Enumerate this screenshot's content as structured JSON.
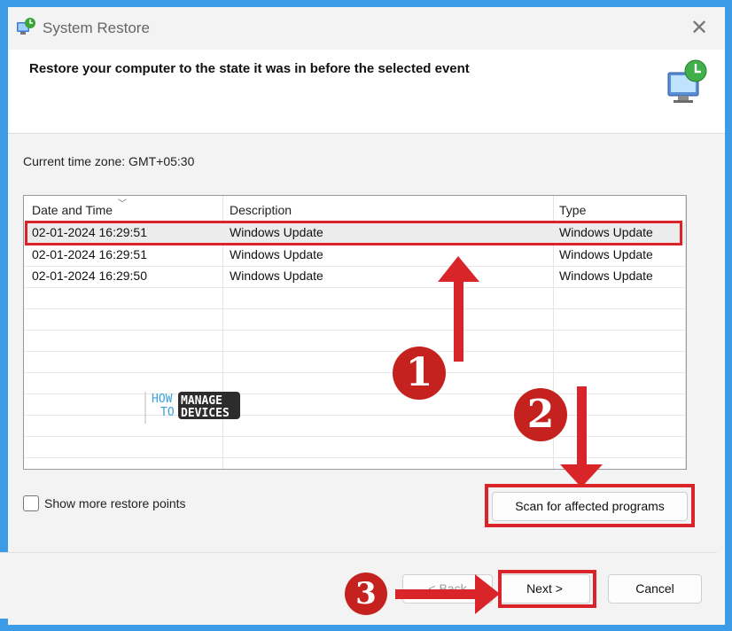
{
  "window": {
    "title": "System Restore",
    "close_glyph": "✕"
  },
  "header": {
    "heading": "Restore your computer to the state it was in before the selected event"
  },
  "timezone_label": "Current time zone: GMT+05:30",
  "table": {
    "columns": [
      "Date and Time",
      "Description",
      "Type"
    ],
    "rows": [
      {
        "date": "02-01-2024 16:29:51",
        "description": "Windows Update",
        "type": "Windows Update"
      },
      {
        "date": "02-01-2024 16:29:51",
        "description": "Windows Update",
        "type": "Windows Update"
      },
      {
        "date": "02-01-2024 16:29:50",
        "description": "Windows Update",
        "type": "Windows Update"
      }
    ]
  },
  "watermark": {
    "how": "HOW",
    "to": "TO",
    "manage": "MANAGE",
    "devices": "DEVICES"
  },
  "checkbox": {
    "label": "Show more restore points",
    "checked": false
  },
  "buttons": {
    "scan": "Scan for affected programs",
    "back": "< Back",
    "next": "Next >",
    "cancel": "Cancel"
  },
  "annotations": {
    "step1": "1",
    "step2": "2",
    "step3": "3",
    "color": "#d9252a"
  }
}
